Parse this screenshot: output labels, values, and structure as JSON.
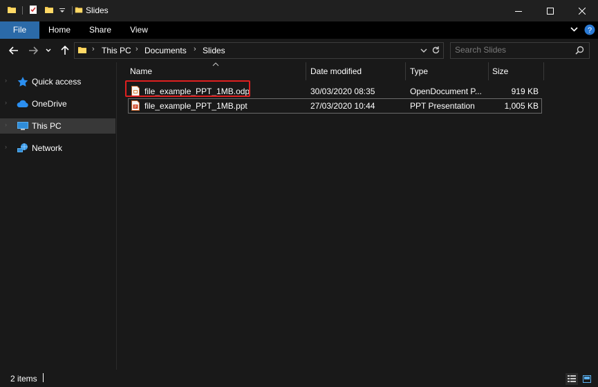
{
  "window": {
    "title": "Slides"
  },
  "ribbon": {
    "tabs": [
      {
        "label": "File"
      },
      {
        "label": "Home"
      },
      {
        "label": "Share"
      },
      {
        "label": "View"
      }
    ]
  },
  "address": {
    "crumbs": [
      "This PC",
      "Documents",
      "Slides"
    ]
  },
  "search": {
    "placeholder": "Search Slides"
  },
  "nav": {
    "items": [
      {
        "label": "Quick access",
        "icon": "star-icon"
      },
      {
        "label": "OneDrive",
        "icon": "cloud-icon"
      },
      {
        "label": "This PC",
        "icon": "computer-icon",
        "selected": true
      },
      {
        "label": "Network",
        "icon": "network-icon"
      }
    ]
  },
  "list": {
    "columns": [
      "Name",
      "Date modified",
      "Type",
      "Size"
    ],
    "rows": [
      {
        "name": "file_example_PPT_1MB.odp",
        "date": "30/03/2020 08:35",
        "type": "OpenDocument P...",
        "size": "919 KB"
      },
      {
        "name": "file_example_PPT_1MB.ppt",
        "date": "27/03/2020 10:44",
        "type": "PPT Presentation",
        "size": "1,005 KB"
      }
    ]
  },
  "status": {
    "count": "2 items"
  },
  "colors": {
    "file_tab": "#2b6aa8",
    "highlight": "#e02020",
    "selected_nav": "#383838"
  }
}
